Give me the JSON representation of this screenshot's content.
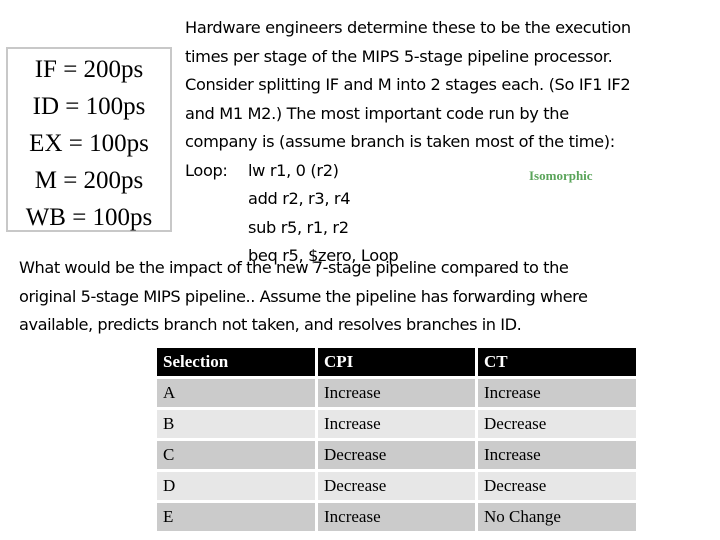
{
  "stage_times": [
    {
      "stage": "IF",
      "text": "IF = 200ps"
    },
    {
      "stage": "ID",
      "text": "ID = 100ps"
    },
    {
      "stage": "EX",
      "text": "EX = 100ps"
    },
    {
      "stage": "M",
      "text": "M = 200ps"
    },
    {
      "stage": "WB",
      "text": "WB = 100ps"
    }
  ],
  "prompt": {
    "lines": [
      "Hardware engineers determine these to be the execution",
      "times per stage of the MIPS 5-stage pipeline processor.",
      "Consider splitting IF and M into 2 stages each.  (So IF1 IF2",
      "and M1 M2.)  The most important code run by the",
      "company is (assume branch is taken most of the time):"
    ],
    "code_label": "Loop:",
    "code": [
      "lw r1, 0 (r2)",
      "add r2, r3, r4",
      "sub r5, r1, r2",
      "beq r5, $zero, Loop"
    ]
  },
  "watermark": "Isomorphic",
  "question": {
    "lines": [
      "What would be the impact of the new 7-stage pipeline compared to the",
      "original 5-stage MIPS pipeline..  Assume the pipeline has forwarding where",
      "available, predicts branch not taken, and resolves branches in ID."
    ]
  },
  "table": {
    "headers": [
      "Selection",
      "CPI",
      "CT"
    ],
    "rows": [
      [
        "A",
        "Increase",
        "Increase"
      ],
      [
        "B",
        "Increase",
        "Decrease"
      ],
      [
        "C",
        "Decrease",
        "Increase"
      ],
      [
        "D",
        "Decrease",
        "Decrease"
      ],
      [
        "E",
        "Increase",
        "No Change"
      ]
    ]
  },
  "colors": {
    "header_bg": "#000000",
    "row_odd_bg": "#cbcbcb",
    "row_even_bg": "#e7e7e7",
    "watermark": "#5aa45a",
    "box_border": "#c8c8c8"
  }
}
